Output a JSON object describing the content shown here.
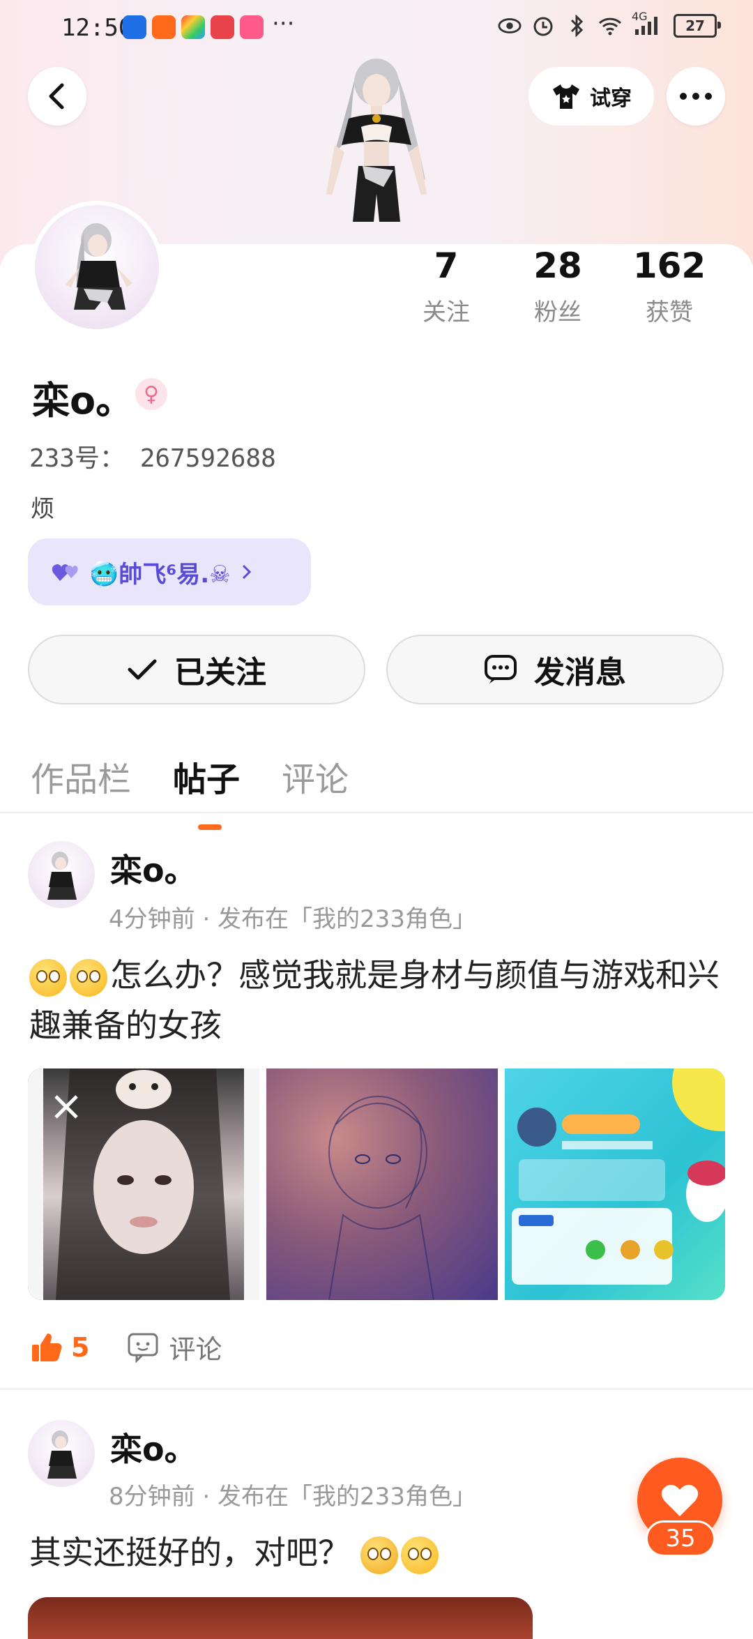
{
  "status": {
    "time": "12:50",
    "more": "···",
    "network": "4G",
    "battery": "27"
  },
  "header": {
    "tryon_label": "试穿"
  },
  "profile": {
    "stats": [
      {
        "value": "7",
        "label": "关注"
      },
      {
        "value": "28",
        "label": "粉丝"
      },
      {
        "value": "162",
        "label": "获赞"
      }
    ],
    "name": "栾o。",
    "gender": "female",
    "id_text": "233号： 267592688",
    "bio": "烦",
    "family_tag": "🥶帥飞⁶易.☠",
    "followed_label": "已关注",
    "message_label": "发消息"
  },
  "tabs": [
    {
      "label": "作品栏",
      "active": false
    },
    {
      "label": "帖子",
      "active": true
    },
    {
      "label": "评论",
      "active": false
    }
  ],
  "posts": [
    {
      "author": "栾o。",
      "meta": "4分钟前 · 发布在「我的233角色」",
      "text": "怎么办？感觉我就是身材与颜值与游戏和兴趣兼备的女孩",
      "likes": "5",
      "comment_label": "评论"
    },
    {
      "author": "栾o。",
      "meta": "8分钟前 · 发布在「我的233角色」",
      "text": "其实还挺好的，对吧？"
    }
  ],
  "floating_like": {
    "count": "35"
  },
  "colors": {
    "accent": "#ff6a1a",
    "tag_bg": "#e9e5fb",
    "tag_text": "#5a4bd6"
  }
}
